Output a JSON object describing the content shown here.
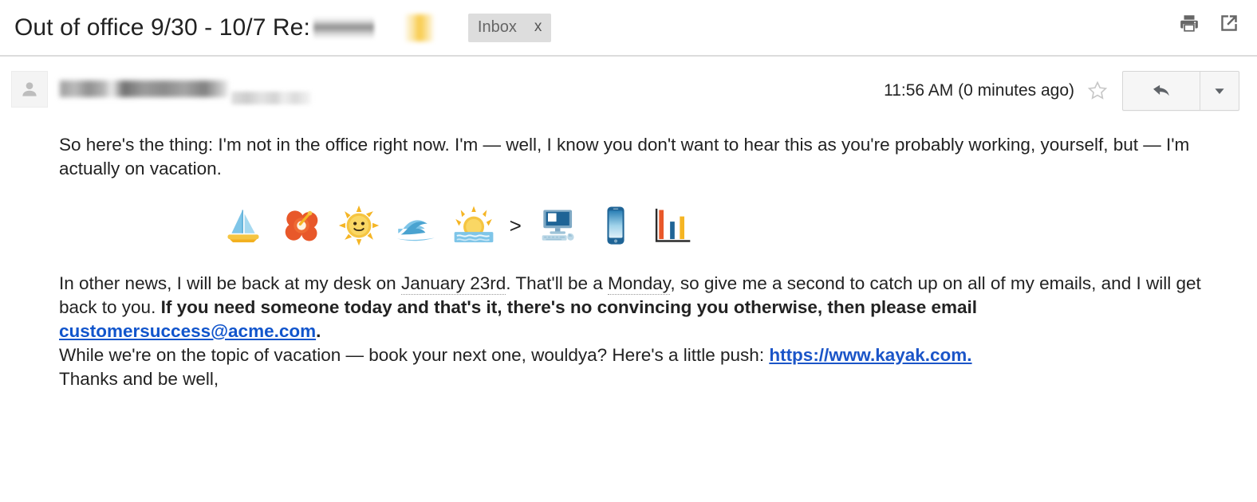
{
  "header": {
    "subject": "Out of office 9/30 - 10/7 Re:",
    "redacted_subject_suffix": true,
    "label_chip": {
      "name": "Inbox",
      "remove_label": "x"
    },
    "actions": [
      {
        "name": "print-icon",
        "label": "Print"
      },
      {
        "name": "open-in-new-window-icon",
        "label": "Open in new window"
      }
    ]
  },
  "message": {
    "avatar_icon": "person-icon",
    "sender_redacted": true,
    "recipient_redacted": true,
    "timestamp": "11:56 AM (0 minutes ago)",
    "star_icon": "star-outline-icon",
    "star_state": "not-starred",
    "reply_icon": "reply-arrow-icon",
    "more_icon": "chevron-down-icon"
  },
  "body": {
    "paragraph_1": "So here's the thing: I'm not in the office right now. I'm — well, I know you don't want to hear this as you're probably working, yourself, but — I'm actually on vacation.",
    "emoji_row": {
      "vacation": [
        "sailboat-emoji",
        "hibiscus-emoji",
        "sun-with-face-emoji",
        "water-wave-emoji",
        "sunrise-over-water-emoji"
      ],
      "separator": ">",
      "work": [
        "desktop-computer-emoji",
        "mobile-phone-emoji",
        "bar-chart-emoji"
      ]
    },
    "paragraph_2": {
      "text_a": "In other news, I will be back at my desk on ",
      "date_1": "January 23rd",
      "text_b": ". That'll be a ",
      "date_2": "Monday",
      "text_c": ", so give me a second to catch up on all of my emails, and I will get back to you. ",
      "bold_a": "If you need someone today and that's it, there's no convincing you otherwise, then please email ",
      "email_link": "customersuccess@acme.com",
      "bold_b": "."
    },
    "paragraph_3": {
      "text_a": "While we're on the topic of vacation — book your next one, wouldya? Here's a little push: ",
      "web_link": "https://www.kayak.com."
    },
    "paragraph_4": "Thanks and be well,"
  },
  "colors": {
    "link_blue": "#1155cc",
    "label_chip_bg": "#dddddd",
    "divider": "#dcdcdc",
    "text": "#222222",
    "emoji_blue": "#5aa7d4",
    "emoji_orange": "#e8582a",
    "emoji_yellow": "#f5b524"
  }
}
